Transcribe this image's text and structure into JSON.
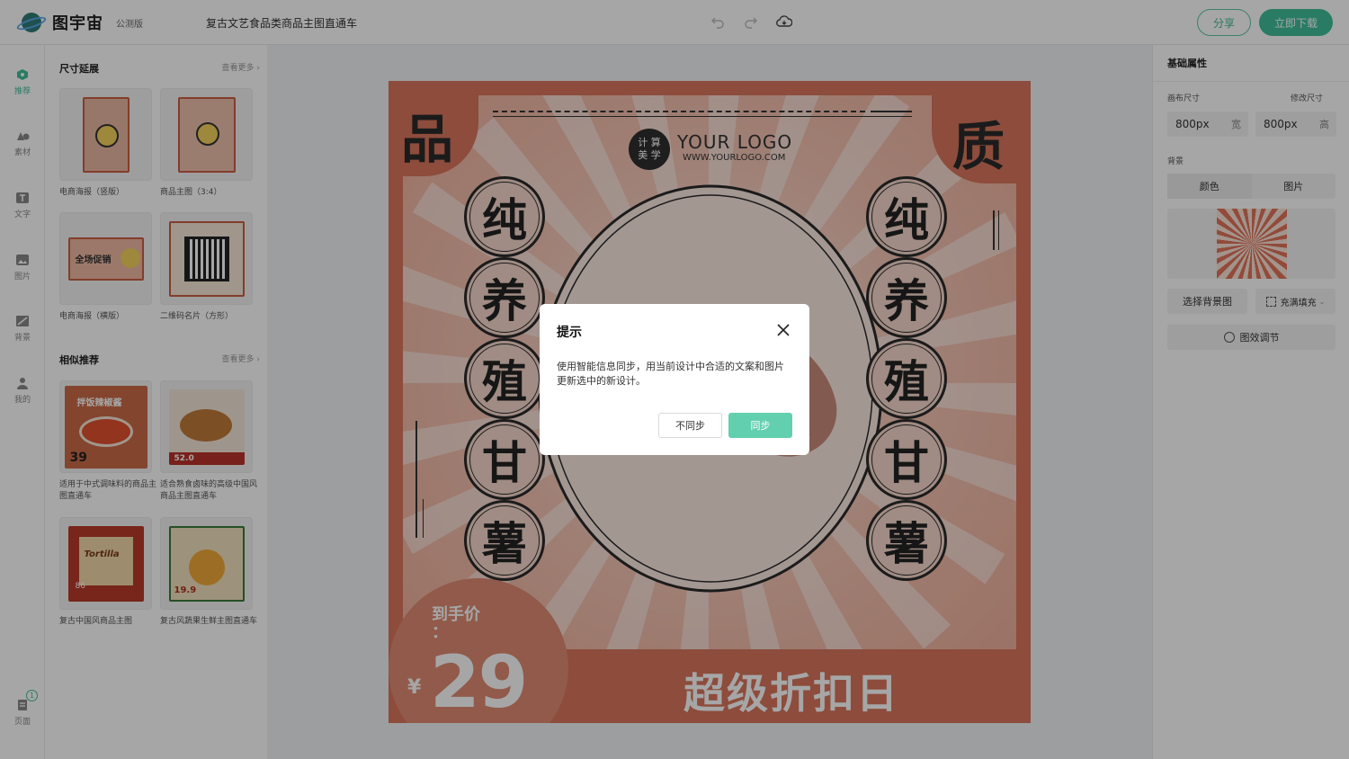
{
  "header": {
    "logo_text": "图宇宙",
    "beta_badge": "公测版",
    "doc_title": "复古文艺食品类商品主图直通车",
    "share_label": "分享",
    "download_label": "立即下载"
  },
  "rail": {
    "items": [
      {
        "label": "推荐",
        "icon": "recommend-icon"
      },
      {
        "label": "素材",
        "icon": "shapes-icon"
      },
      {
        "label": "文字",
        "icon": "text-icon"
      },
      {
        "label": "图片",
        "icon": "image-icon"
      },
      {
        "label": "背景",
        "icon": "background-icon"
      },
      {
        "label": "我的",
        "icon": "user-icon"
      }
    ],
    "pages_label": "页面",
    "pages_count": "1"
  },
  "panel": {
    "size_section": {
      "title": "尺寸延展",
      "more": "查看更多"
    },
    "size_items": [
      {
        "caption": "电商海报（竖版）"
      },
      {
        "caption": "商品主图（3:4）"
      },
      {
        "caption": "电商海报（横版）"
      },
      {
        "caption": "二维码名片（方形）"
      }
    ],
    "similar_section": {
      "title": "相似推荐",
      "more": "查看更多"
    },
    "similar_items": [
      {
        "caption": "适用于中式调味料的商品主图直通车"
      },
      {
        "caption": "适合熟食卤味的高级中国风商品主图直通车"
      },
      {
        "caption": "复古中国风商品主图"
      },
      {
        "caption": "复古风蔬果生鲜主图直通车"
      }
    ],
    "thumb_texts": {
      "promo": "全场促销",
      "seasoning": "拌饭辣椒酱",
      "seasoning_price": "39",
      "duck_price": "52.0",
      "tortilla": "Tortilla",
      "tortilla_price": "86",
      "mango_price": "19.9"
    }
  },
  "canvas": {
    "corner_left": "品",
    "corner_right": "质",
    "column_chars": [
      "纯",
      "养",
      "殖",
      "甘",
      "薯"
    ],
    "logo_badge": "计 算\n美 学",
    "logo_main": "YOUR LOGO",
    "logo_sub": "WWW.YOURLOGO.COM",
    "price_label": "到手价\n：",
    "price_currency": "¥",
    "price_value": "29",
    "slogan": "超级折扣日"
  },
  "right_panel": {
    "title": "基础属性",
    "canvas_size_label": "画布尺寸",
    "edit_size_label": "修改尺寸",
    "width_value": "800px",
    "width_unit": "宽",
    "height_value": "800px",
    "height_unit": "高",
    "background_label": "背景",
    "tab_color": "颜色",
    "tab_image": "图片",
    "choose_bg": "选择背景图",
    "fill_mode": "充满填充",
    "effect_adjust": "图效调节"
  },
  "dialog": {
    "title": "提示",
    "body": "使用智能信息同步，用当前设计中合适的文案和图片更新选中的新设计。",
    "cancel_label": "不同步",
    "confirm_label": "同步"
  },
  "colors": {
    "accent": "#3fbf98",
    "poster_orange": "#d9765d",
    "confirm_button": "#62cfae"
  }
}
